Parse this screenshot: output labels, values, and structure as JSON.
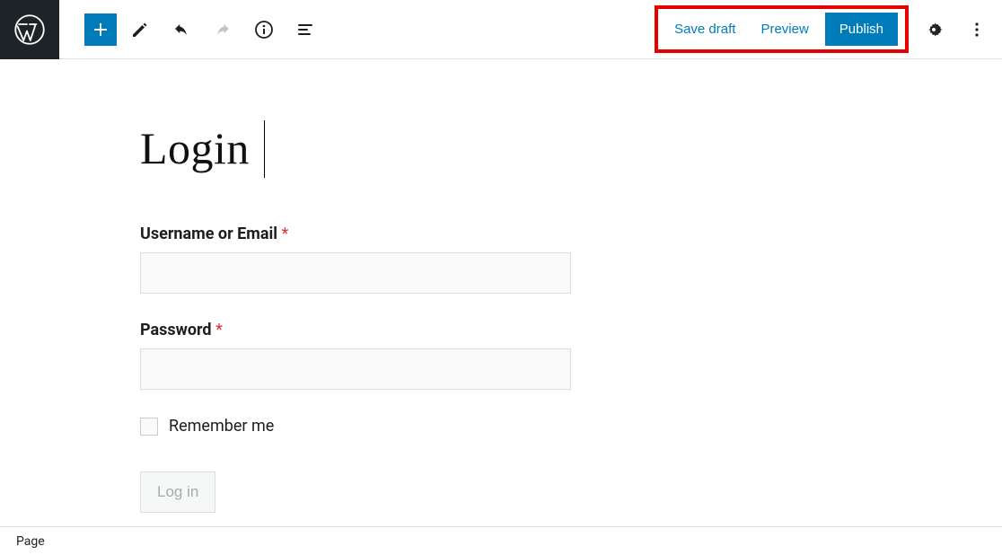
{
  "toolbar": {
    "save_draft": "Save draft",
    "preview": "Preview",
    "publish": "Publish"
  },
  "page": {
    "title": "Login"
  },
  "form": {
    "username_label": "Username or Email",
    "password_label": "Password",
    "required_marker": "*",
    "remember_label": "Remember me",
    "submit_label": "Log in"
  },
  "footer": {
    "breadcrumb": "Page"
  },
  "icons": {
    "wp_logo": "wordpress-logo-icon",
    "add": "plus-icon",
    "edit": "pencil-icon",
    "undo": "undo-icon",
    "redo": "redo-icon",
    "info": "info-icon",
    "outline": "outline-icon",
    "settings": "gear-icon",
    "more": "more-vertical-icon"
  }
}
